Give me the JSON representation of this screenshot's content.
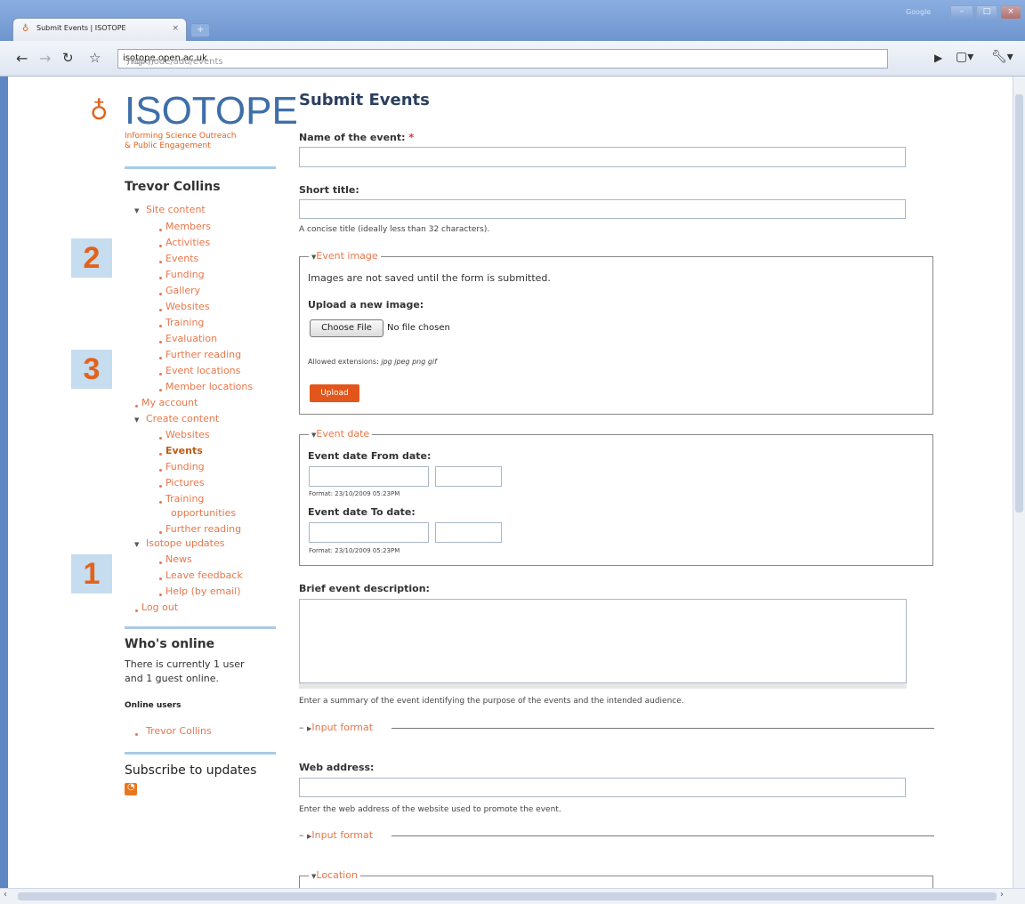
{
  "browser": {
    "tab_title": "Submit Events | ISOTOPE",
    "url_host": "isotope.open.ac.uk",
    "url_prefix": "http://",
    "url_path": "/?q=node/add/events",
    "google_label": "Google"
  },
  "site": {
    "logo_text": "ISOTOPE",
    "tagline_line1": "Informing Science Outreach",
    "tagline_line2": "& Public Engagement"
  },
  "sidebar": {
    "user_name": "Trevor Collins",
    "site_content": "Site content",
    "site_items": [
      "Members",
      "Activities",
      "Events",
      "Funding",
      "Gallery",
      "Websites",
      "Training",
      "Evaluation",
      "Further reading",
      "Event locations",
      "Member locations"
    ],
    "my_account": "My account",
    "create_content": "Create content",
    "create_items": [
      "Websites",
      "Events",
      "Funding",
      "Pictures",
      "Training",
      "opportunities",
      "Further reading"
    ],
    "isotope_updates": "Isotope updates",
    "update_items": [
      "News",
      "Leave feedback",
      "Help (by email)"
    ],
    "log_out": "Log out",
    "whos_online_title": "Who's online",
    "whos_online_text1": "There is currently 1 user",
    "whos_online_text2": "and 1 guest online.",
    "online_users_label": "Online users",
    "online_user": "Trevor Collins",
    "subscribe_title": "Subscribe to updates",
    "markers": [
      "2",
      "3",
      "1"
    ]
  },
  "form": {
    "title": "Submit Events",
    "name_label": "Name of the event:",
    "required_mark": "*",
    "short_title_label": "Short title:",
    "short_title_help": "A concise title (ideally less than 32 characters).",
    "event_image_legend": "Event image",
    "images_note": "Images are not saved until the form is submitted.",
    "upload_label": "Upload a new image:",
    "choose_file": "Choose File",
    "no_file": "No file chosen",
    "allowed_ext_prefix": "Allowed extensions:",
    "allowed_ext": "jpg jpeg png gif",
    "upload_button": "Upload",
    "event_date_legend": "Event date",
    "from_label": "Event date From date:",
    "to_label": "Event date To date:",
    "format_hint": "Format: 23/10/2009 05:23PM",
    "brief_label": "Brief event description:",
    "brief_help": "Enter a summary of the event identifying the purpose of the events and the intended audience.",
    "input_format": "Input format",
    "web_label": "Web address:",
    "web_help": "Enter the web address of the website used to promote the event.",
    "location_legend": "Location"
  }
}
